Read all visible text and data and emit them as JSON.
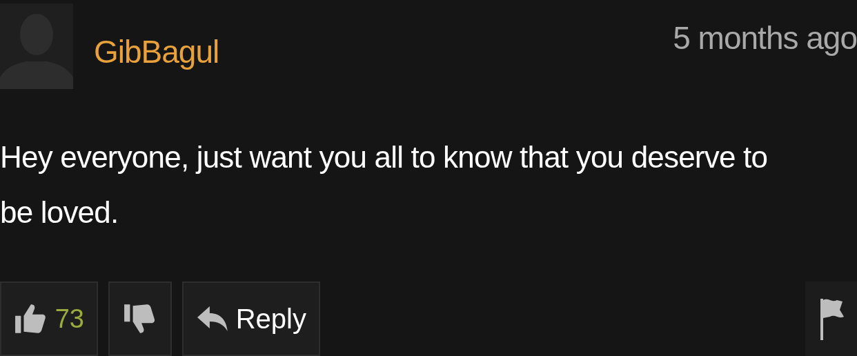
{
  "comment": {
    "author": "GibBagul",
    "time": "5 months ago",
    "body": "Hey everyone, just want you all to know that you deserve to be loved.",
    "likes": "73",
    "reply_label": "Reply"
  }
}
